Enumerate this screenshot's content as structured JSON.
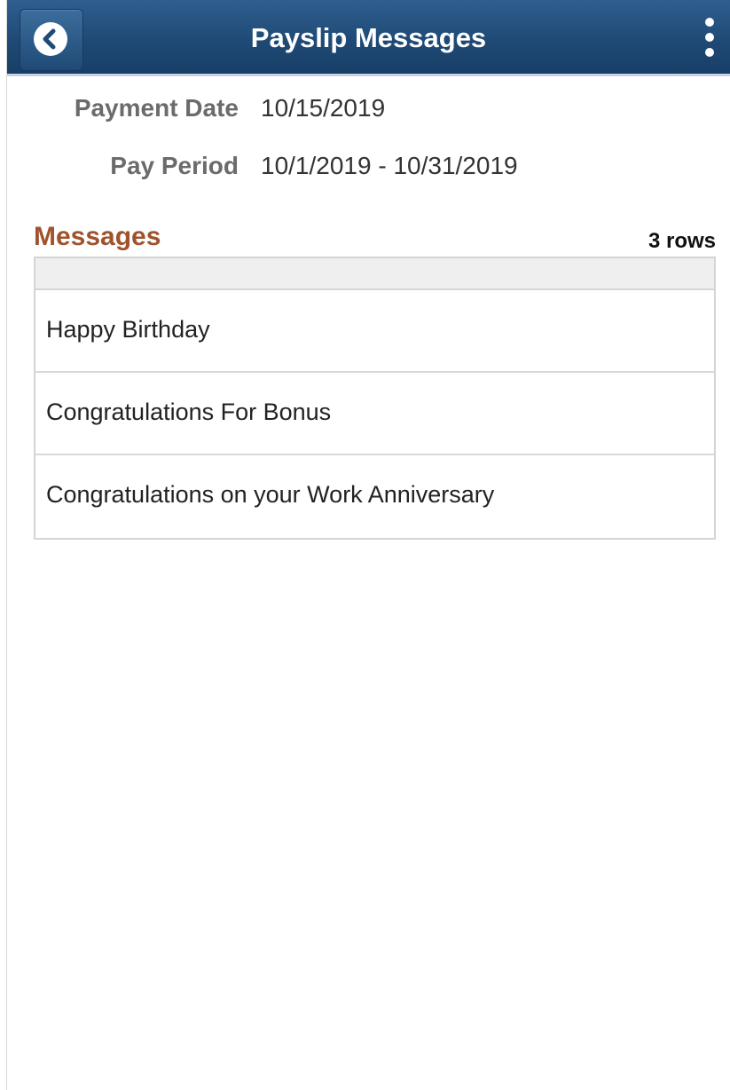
{
  "header": {
    "title": "Payslip Messages",
    "back_icon": "chevron-left-icon",
    "menu_icon": "more-vertical-icon"
  },
  "details": {
    "payment_date_label": "Payment Date",
    "payment_date_value": "10/15/2019",
    "pay_period_label": "Pay Period",
    "pay_period_value": "10/1/2019 - 10/31/2019"
  },
  "messages": {
    "title": "Messages",
    "row_count": "3 rows",
    "rows": [
      "Happy Birthday",
      "Congratulations For Bonus",
      "Congratulations on your Work Anniversary"
    ]
  },
  "colors": {
    "header_bg": "#1f4a76",
    "section_title": "#a0522d"
  }
}
